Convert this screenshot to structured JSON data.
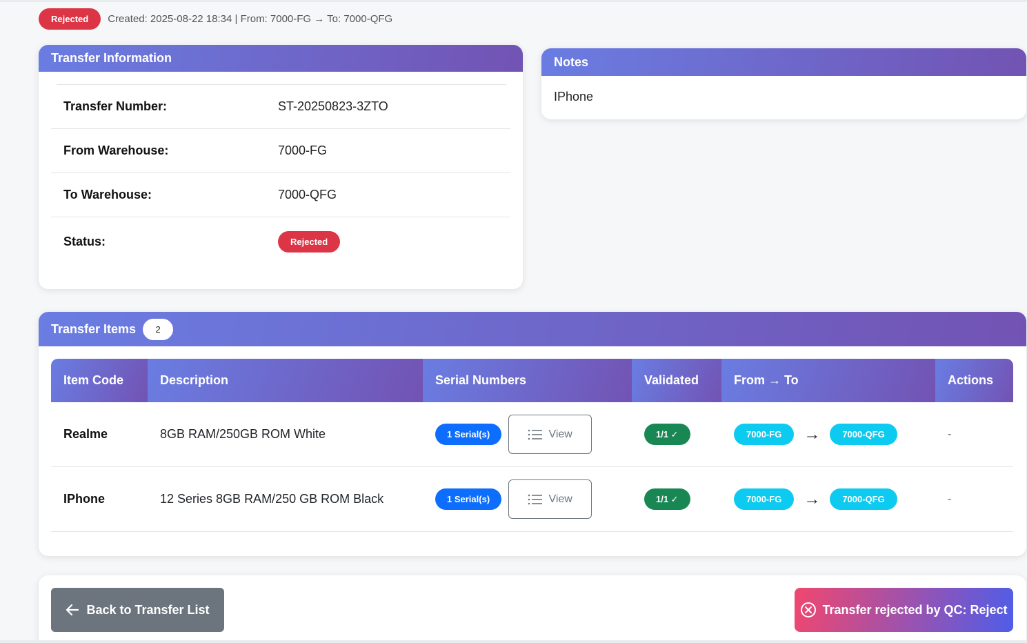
{
  "header": {
    "status_badge": "Rejected",
    "meta": "Created: 2025-08-22 18:34 | From: 7000-FG → To: 7000-QFG"
  },
  "transfer_info": {
    "title": "Transfer Information",
    "rows": [
      {
        "label": "Transfer Number:",
        "value": "ST-20250823-3ZTO"
      },
      {
        "label": "From Warehouse:",
        "value": "7000-FG"
      },
      {
        "label": "To Warehouse:",
        "value": "7000-QFG"
      },
      {
        "label": "Status:",
        "value": "Rejected"
      }
    ]
  },
  "notes": {
    "title": "Notes",
    "text": "IPhone"
  },
  "items": {
    "title": "Transfer Items",
    "count": "2",
    "columns": [
      "Item Code",
      "Description",
      "Serial Numbers",
      "Validated",
      "From → To",
      "Actions"
    ],
    "rows": [
      {
        "code": "Realme",
        "description": "8GB RAM/250GB ROM White",
        "serials": "1 Serial(s)",
        "view": "View",
        "validated": "1/1 ✓",
        "from": "7000-FG",
        "to": "7000-QFG",
        "actions": "-"
      },
      {
        "code": "IPhone",
        "description": "12 Series 8GB RAM/250 GB ROM Black",
        "serials": "1 Serial(s)",
        "view": "View",
        "validated": "1/1 ✓",
        "from": "7000-FG",
        "to": "7000-QFG",
        "actions": "-"
      }
    ]
  },
  "footer": {
    "back_label": "Back to Transfer List",
    "rejected_label": "Transfer rejected by QC: Reject"
  },
  "colors": {
    "header_gradient_start": "#6a7de2",
    "header_gradient_end": "#7253b3",
    "danger": "#dc3545",
    "primary": "#0d6efd",
    "success": "#198754",
    "info": "#0dcaf0",
    "secondary": "#6c757d"
  }
}
